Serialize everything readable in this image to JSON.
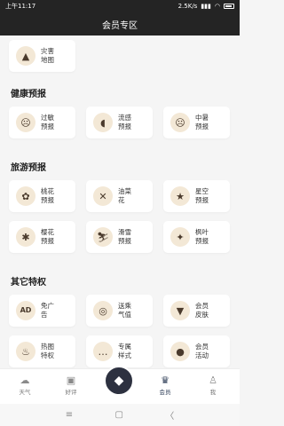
{
  "status_bar": {
    "time": "上午11:17",
    "network_speed": "2.5K/s",
    "signal": "▮▮▮",
    "wifi": "◠"
  },
  "header": {
    "title": "会员专区"
  },
  "sections": [
    {
      "title": "",
      "items": [
        {
          "label": "灾害地图",
          "icon": "warning-icon",
          "glyph": "▲"
        }
      ]
    },
    {
      "title": "健康预报",
      "items": [
        {
          "label": "过敏预报",
          "icon": "sad-face-icon",
          "glyph": "☹"
        },
        {
          "label": "流感预报",
          "icon": "pill-icon",
          "glyph": "◖"
        },
        {
          "label": "中暑预报",
          "icon": "dizzy-face-icon",
          "glyph": "☹"
        }
      ]
    },
    {
      "title": "旅游预报",
      "items": [
        {
          "label": "桃花预报",
          "icon": "flower-icon",
          "glyph": "✿"
        },
        {
          "label": "油菜花",
          "icon": "butterfly-icon",
          "glyph": "✕"
        },
        {
          "label": "星空预报",
          "icon": "star-icon",
          "glyph": "★"
        },
        {
          "label": "樱花预报",
          "icon": "blossom-icon",
          "glyph": "✱"
        },
        {
          "label": "滑雪预报",
          "icon": "skiing-icon",
          "glyph": "⛷"
        },
        {
          "label": "枫叶预报",
          "icon": "maple-leaf-icon",
          "glyph": "✦"
        }
      ]
    },
    {
      "title": "其它特权",
      "items": [
        {
          "label": "免广告",
          "icon": "ad-icon",
          "glyph": "AD"
        },
        {
          "label": "送乘气值",
          "icon": "coin-icon",
          "glyph": "◎"
        },
        {
          "label": "会员皮肤",
          "icon": "shirt-icon",
          "glyph": "▼"
        },
        {
          "label": "热图特权",
          "icon": "flame-icon",
          "glyph": "♨"
        },
        {
          "label": "专属样式",
          "icon": "chat-icon",
          "glyph": "…"
        },
        {
          "label": "会员活动",
          "icon": "ball-icon",
          "glyph": "●"
        }
      ]
    }
  ],
  "bottom_nav": [
    {
      "label": "天气",
      "icon": "cloud-icon",
      "glyph": "☁"
    },
    {
      "label": "好评",
      "icon": "image-icon",
      "glyph": "▣"
    },
    {
      "label": "",
      "icon": "center-logo-icon",
      "glyph": "◆"
    },
    {
      "label": "会员",
      "icon": "crown-icon",
      "glyph": "♛"
    },
    {
      "label": "我",
      "icon": "user-icon",
      "glyph": "♙"
    }
  ],
  "system_nav": {
    "menu": "≡",
    "home": "▢",
    "back": "〈"
  }
}
